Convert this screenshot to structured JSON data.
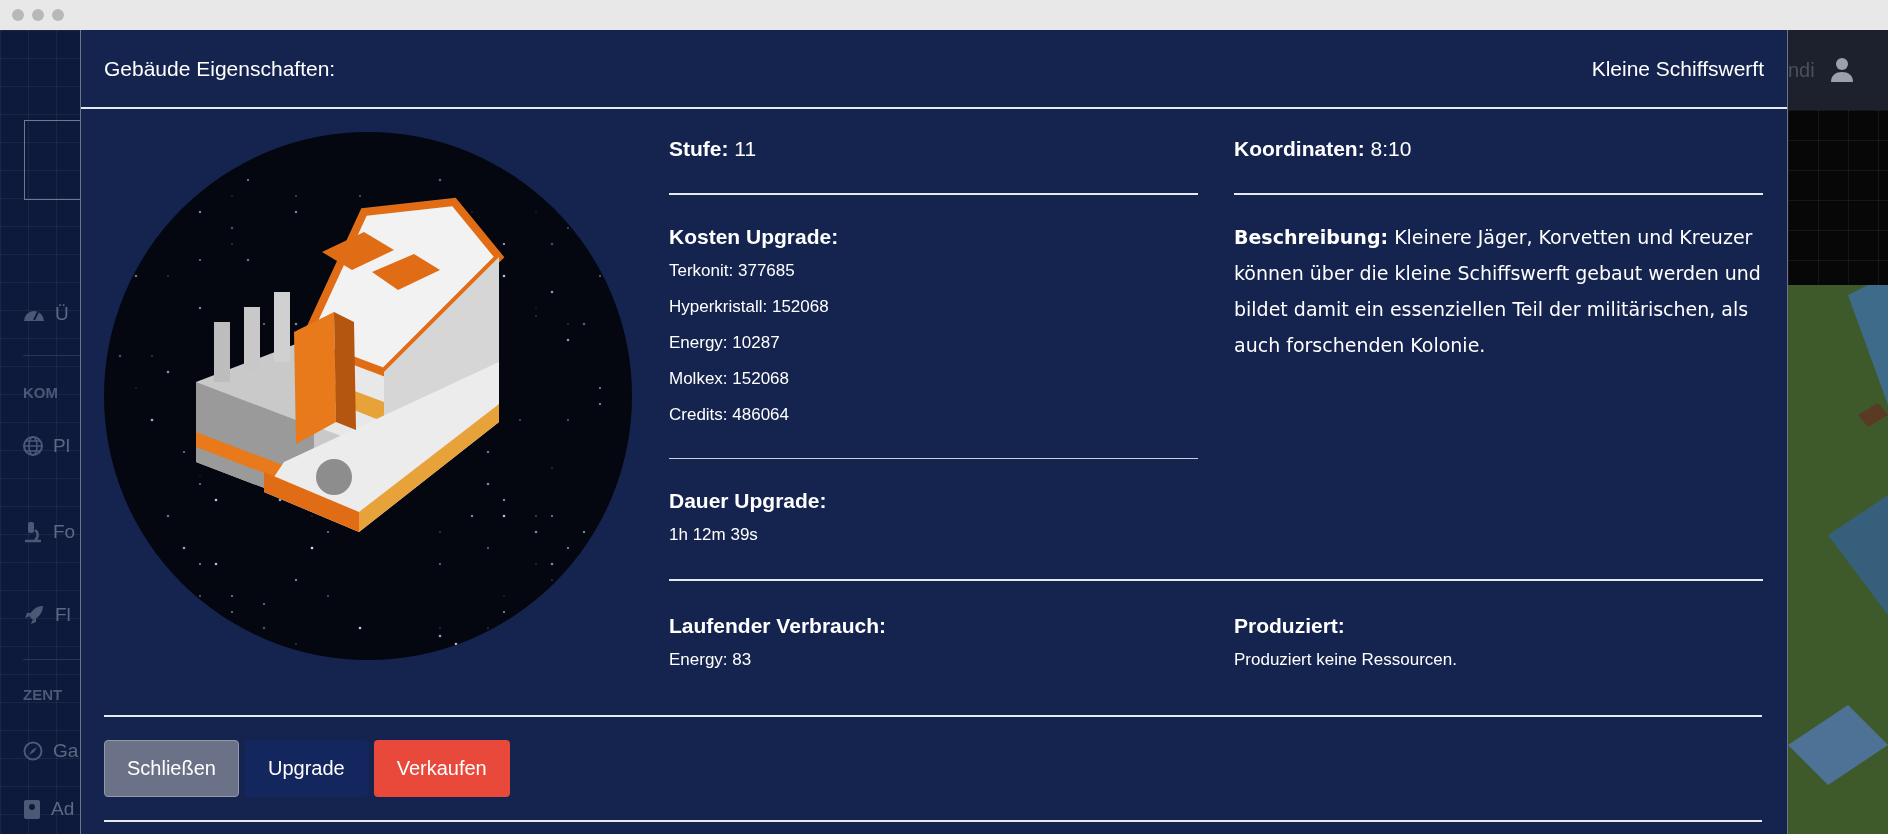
{
  "sidebar": {
    "items": [
      {
        "kind": "item",
        "label": "Ü"
      },
      {
        "kind": "section",
        "label": "KOM"
      },
      {
        "kind": "item",
        "label": "Pl"
      },
      {
        "kind": "item",
        "label": "Fo"
      },
      {
        "kind": "item",
        "label": "Fl"
      },
      {
        "kind": "section",
        "label": "ZENT"
      },
      {
        "kind": "item",
        "label": "Ga"
      },
      {
        "kind": "item",
        "label": "Ad"
      }
    ]
  },
  "top_bar": {
    "user_name": "ndi"
  },
  "modal": {
    "title": "Gebäude Eigenschaften:",
    "building_name": "Kleine Schiffswerft",
    "level": {
      "label": "Stufe:",
      "value": "11"
    },
    "coordinates": {
      "label": "Koordinaten:",
      "value": "8:10"
    },
    "upgrade_cost": {
      "title": "Kosten Upgrade:",
      "items": [
        "Terkonit: 377685",
        "Hyperkristall: 152068",
        "Energy: 10287",
        "Molkex: 152068",
        "Credits: 486064"
      ]
    },
    "description": {
      "label": "Beschreibung:",
      "text": "Kleinere Jäger, Korvetten und Kreuzer können über die kleine Schiffswerft gebaut werden und bildet damit ein essenziellen Teil der militärischen, als auch forschenden Kolonie."
    },
    "upgrade_duration": {
      "title": "Dauer Upgrade:",
      "value": "1h 12m 39s"
    },
    "running_consumption": {
      "title": "Laufender Verbrauch:",
      "items": [
        "Energy: 83"
      ]
    },
    "production": {
      "title": "Produziert:",
      "items": [
        "Produziert keine Ressourcen."
      ]
    },
    "buttons": [
      {
        "label": "Schließen",
        "kind": "secondary"
      },
      {
        "label": "Upgrade",
        "kind": "primary"
      },
      {
        "label": "Verkaufen",
        "kind": "danger"
      }
    ]
  }
}
